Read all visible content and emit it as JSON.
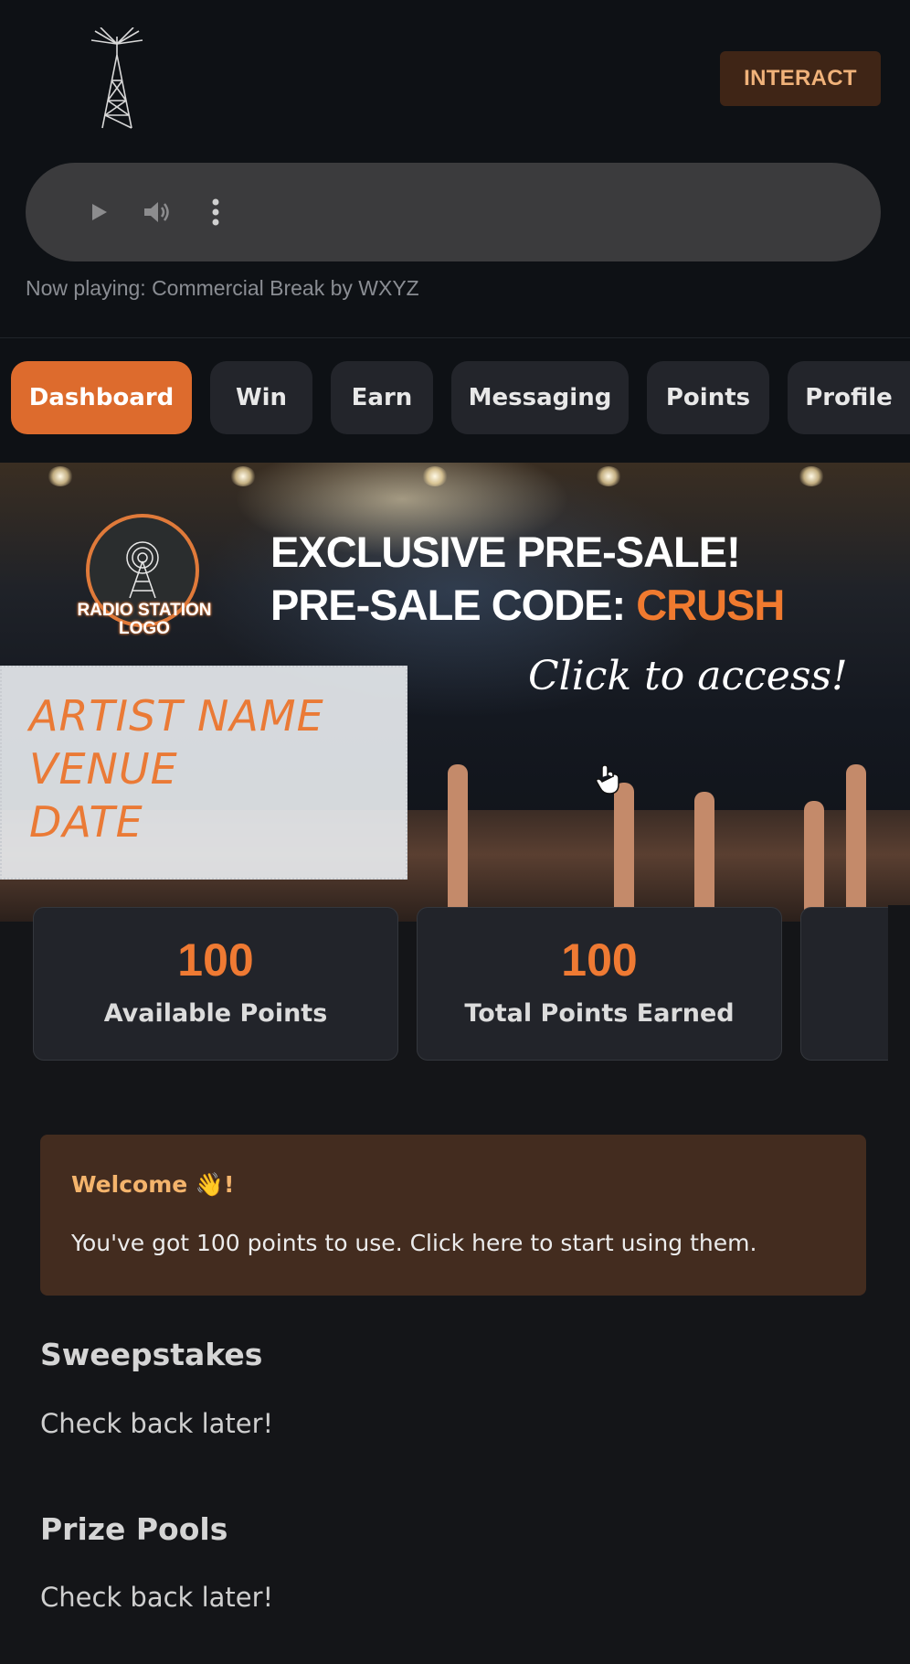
{
  "header": {
    "interact_label": "INTERACT",
    "logo_icon": "radio-tower-icon"
  },
  "player": {
    "play_icon": "play-icon",
    "volume_icon": "volume-icon",
    "more_icon": "more-vertical-icon",
    "now_playing": "Now playing: Commercial Break by WXYZ"
  },
  "tabs": [
    {
      "label": "Dashboard",
      "active": true
    },
    {
      "label": "Win",
      "active": false
    },
    {
      "label": "Earn",
      "active": false
    },
    {
      "label": "Messaging",
      "active": false
    },
    {
      "label": "Points",
      "active": false
    },
    {
      "label": "Profile",
      "active": false
    }
  ],
  "banner": {
    "logo_text_line1": "RADIO STATION",
    "logo_text_line2": "LOGO",
    "headline_1": "EXCLUSIVE PRE-SALE!",
    "headline_2_prefix": "PRE-SALE CODE: ",
    "headline_2_code": "CRUSH",
    "cta": "Click to access!",
    "artist_line": "ARTIST NAME",
    "venue_line": "VENUE",
    "date_line": "DATE"
  },
  "stats": [
    {
      "value": "100",
      "label": "Available Points"
    },
    {
      "value": "100",
      "label": "Total Points Earned"
    }
  ],
  "welcome": {
    "title": "Welcome 👋!",
    "text": "You've got 100 points to use. Click here to start using them."
  },
  "sections": [
    {
      "title": "Sweepstakes",
      "text": "Check back later!"
    },
    {
      "title": "Prize Pools",
      "text": "Check back later!"
    }
  ],
  "colors": {
    "accent": "#dd6b2d",
    "points": "#ef7a33",
    "background": "#141518",
    "welcome_bg": "#432c1f"
  }
}
